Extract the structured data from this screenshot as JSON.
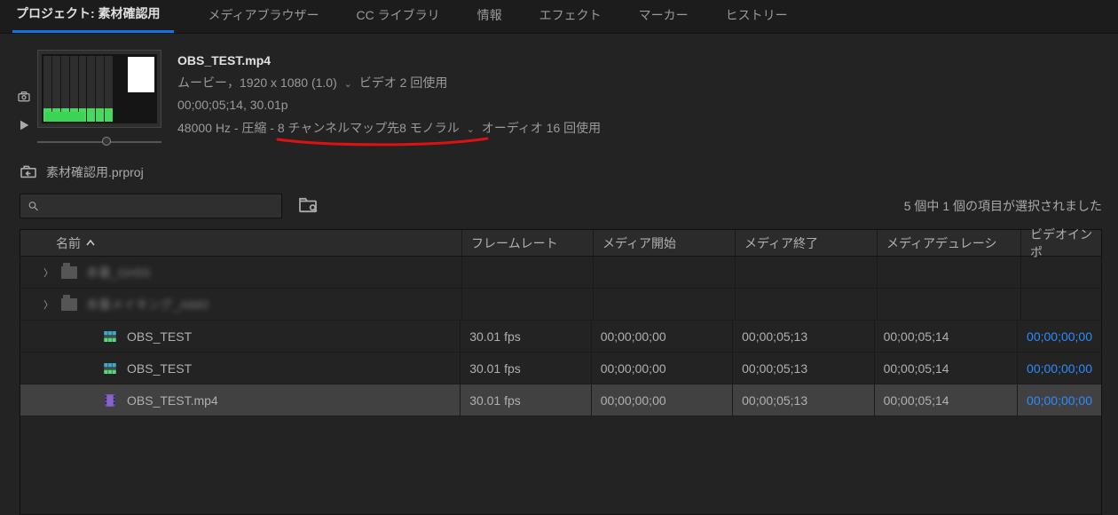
{
  "tabs": [
    {
      "label": "プロジェクト: 素材確認用",
      "active": true
    },
    {
      "label": "メディアブラウザー"
    },
    {
      "label": "CC ライブラリ"
    },
    {
      "label": "情報"
    },
    {
      "label": "エフェクト"
    },
    {
      "label": "マーカー"
    },
    {
      "label": "ヒストリー"
    }
  ],
  "preview": {
    "file_title": "OBS_TEST.mp4",
    "line1a": "ムービー，1920 x 1080 (1.0)",
    "line1b": "ビデオ 2 回使用",
    "line2": "00;00;05;14, 30.01p",
    "line3a": "48000 Hz - 圧縮 -",
    "line3_highlight": "8 チャンネルマップ先8 モノラル",
    "line3b": "オーディオ 16 回使用"
  },
  "project_file": "素材確認用.prproj",
  "search_placeholder": "",
  "status": "5 個中 1 個の項目が選択されました",
  "columns": {
    "name": "名前",
    "fps": "フレームレート",
    "m1": "メディア開始",
    "m2": "メディア終了",
    "m3": "メディアデュレーシ",
    "m4": "ビデオインポ"
  },
  "rows": [
    {
      "type": "folder",
      "name": "本番_GH55",
      "blurred": true
    },
    {
      "type": "folder",
      "name": "本番メイキング_A860",
      "blurred": true
    },
    {
      "type": "sequence",
      "name": "OBS_TEST",
      "fps": "30.01 fps",
      "m1": "00;00;00;00",
      "m2": "00;00;05;13",
      "m3": "00;00;05;14",
      "m4": "00;00;00;00"
    },
    {
      "type": "sequence",
      "name": "OBS_TEST",
      "fps": "30.01 fps",
      "m1": "00;00;00;00",
      "m2": "00;00;05;13",
      "m3": "00;00;05;14",
      "m4": "00;00;00;00"
    },
    {
      "type": "movie",
      "name": "OBS_TEST.mp4",
      "fps": "30.01 fps",
      "m1": "00;00;00;00",
      "m2": "00;00;05;13",
      "m3": "00;00;05;14",
      "m4": "00;00;00;00",
      "selected": true
    }
  ]
}
